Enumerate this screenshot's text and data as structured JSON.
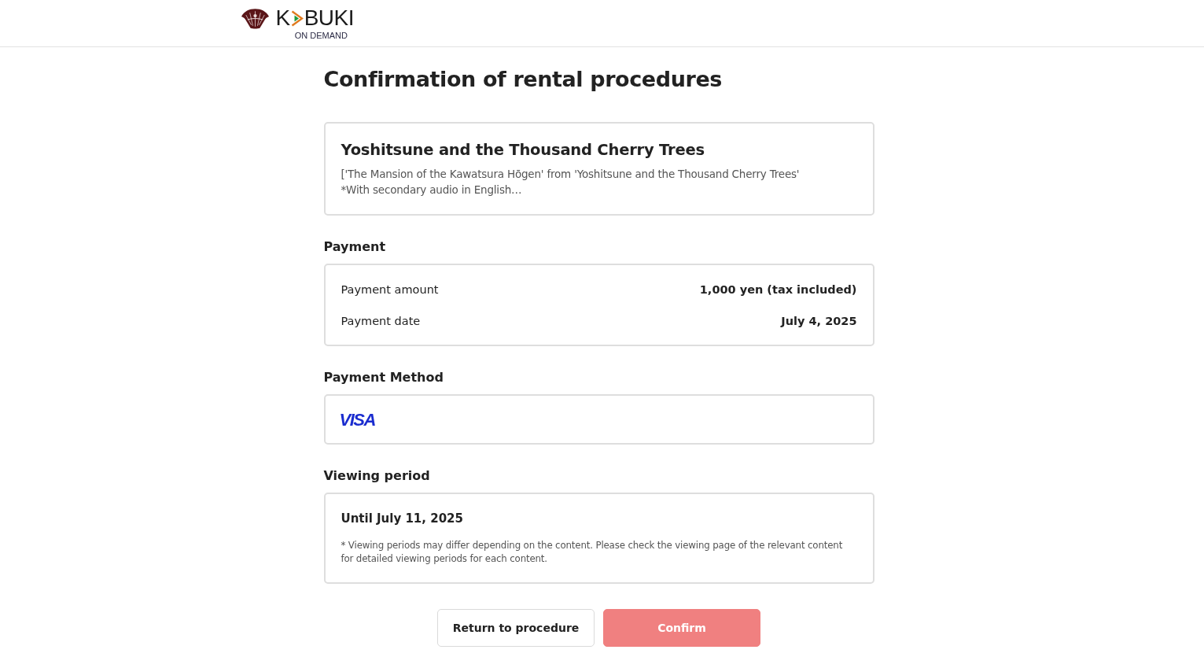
{
  "header": {
    "logo": {
      "text_before": "K",
      "text_after": "BUKI",
      "tagline": "ON DEMAND"
    }
  },
  "page_title": "Confirmation of rental procedures",
  "program": {
    "title": "Yoshitsune and the Thousand Cherry Trees",
    "description_lines": [
      "['The Mansion of the Kawatsura Hōgen' from 'Yoshitsune and the Thousand Cherry Trees'",
      "*With secondary audio in English…"
    ]
  },
  "payment": {
    "heading": "Payment",
    "rows": [
      {
        "label": "Payment amount",
        "value": "1,000 yen (tax included)"
      },
      {
        "label": "Payment date",
        "value": "July 4, 2025"
      }
    ]
  },
  "payment_method": {
    "heading": "Payment Method",
    "card_brand": "VISA"
  },
  "viewing_period": {
    "heading": "Viewing period",
    "until": "Until July 11, 2025",
    "note": "* Viewing periods may differ depending on the content. Please check the viewing page of the relevant content for detailed viewing periods for each content."
  },
  "buttons": [
    {
      "label": "Return to procedure",
      "kind": "secondary",
      "disabled": false
    },
    {
      "label": "Confirm",
      "kind": "primary",
      "disabled": true
    }
  ]
}
